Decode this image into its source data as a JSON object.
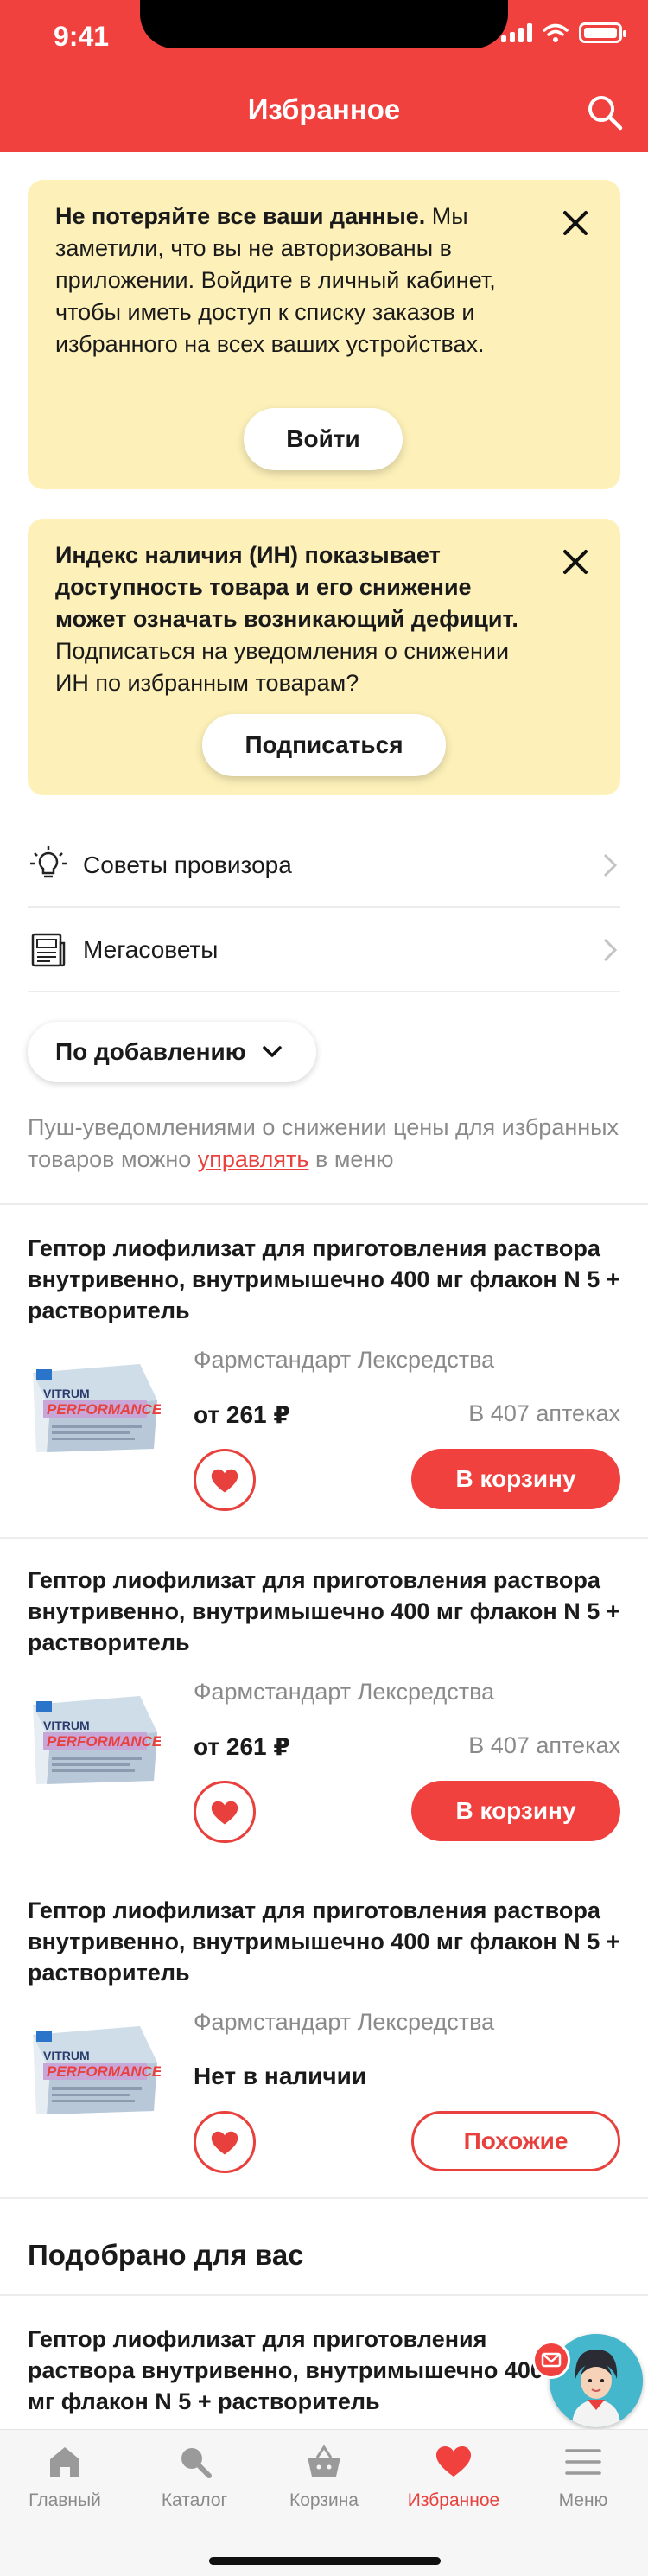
{
  "status_bar": {
    "time": "9:41"
  },
  "header": {
    "title": "Избранное"
  },
  "auth_card": {
    "bold": "Не потеряйте все ваши данные.",
    "text": " Мы заметили, что вы не авторизованы в приложении. Войдите в личный кабинет, чтобы иметь доступ к списку заказов и избранного на всех ваших устройствах.",
    "button": "Войти"
  },
  "index_card": {
    "bold": "Индекс наличия (ИН) показывает доступность товара и его снижение может означать возникающий дефицит.",
    "text": " Подписаться на уведомления о снижении ИН по избранным товарам?",
    "button": "Подписаться"
  },
  "links": [
    {
      "label": "Советы провизора",
      "icon": "lightbulb-icon"
    },
    {
      "label": "Мегасоветы",
      "icon": "newspaper-icon"
    }
  ],
  "sort": {
    "label": "По добавлению"
  },
  "push_note": {
    "before": "Пуш-уведомлениями о снижении цены для избранных товаров можно ",
    "link": "управлять",
    "after": " в меню"
  },
  "products": [
    {
      "title": "Гептор лиофилизат для приготовления раствора внутривенно, внутримышечно 400 мг флакон N 5 + растворитель",
      "maker": "Фармстандарт Лексредства",
      "price": "от 261 ₽",
      "availability": "В 407 аптеках",
      "action": "В корзину"
    },
    {
      "title": "Гептор лиофилизат для приготовления раствора внутривенно, внутримышечно 400 мг флакон N 5 + растворитель",
      "maker": "Фармстандарт Лексредства",
      "price": "от 261 ₽",
      "availability": "В 407 аптеках",
      "action": "В корзину"
    },
    {
      "title": "Гептор лиофилизат для приготовления раствора внутривенно, внутримышечно 400 мг флакон N 5 + растворитель",
      "maker": "Фармстандарт Лексредства",
      "price": "Нет в наличии",
      "availability": "",
      "action": "Похожие"
    }
  ],
  "product_image_text": {
    "brand": "VITRUM",
    "line": "PERFORMANCE"
  },
  "recommended": {
    "title": "Подобрано для вас",
    "item_title": "Гептор лиофилизат для приготовления раствора внутривенно, внутримышечно 400 мг флакон N 5 + растворитель"
  },
  "tabbar": [
    {
      "label": "Главный",
      "icon": "home-icon",
      "active": false
    },
    {
      "label": "Каталог",
      "icon": "catalog-search-icon",
      "active": false
    },
    {
      "label": "Корзина",
      "icon": "basket-icon",
      "active": false
    },
    {
      "label": "Избранное",
      "icon": "heart-icon",
      "active": true
    },
    {
      "label": "Меню",
      "icon": "menu-icon",
      "active": false
    }
  ],
  "colors": {
    "accent": "#f0413f",
    "card_bg": "#fdf1b9",
    "muted_text": "#8a8a8a"
  }
}
